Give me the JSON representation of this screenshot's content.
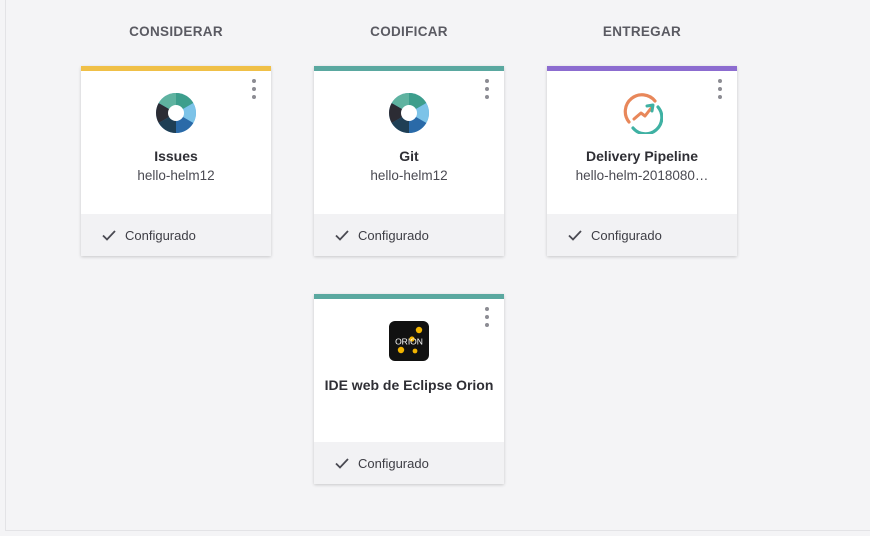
{
  "columns": {
    "consider": "CONSIDERAR",
    "code": "CODIFICAR",
    "deliver": "ENTREGAR"
  },
  "colors": {
    "consider_bar": "#f0c048",
    "code_bar": "#5aa8a0",
    "deliver_bar": "#8c6cd0"
  },
  "cards": {
    "issues": {
      "title": "Issues",
      "subtitle": "hello-helm12",
      "status": "Configurado",
      "icon": "issues-logo-icon"
    },
    "git": {
      "title": "Git",
      "subtitle": "hello-helm12",
      "status": "Configurado",
      "icon": "git-logo-icon"
    },
    "pipeline": {
      "title": "Delivery Pipeline",
      "subtitle": "hello-helm-2018080…",
      "status": "Configurado",
      "icon": "delivery-pipeline-icon"
    },
    "orion": {
      "title": "IDE web de Eclipse Orion",
      "status": "Configurado",
      "icon": "orion-logo-icon",
      "logo_text": "ORION"
    }
  }
}
